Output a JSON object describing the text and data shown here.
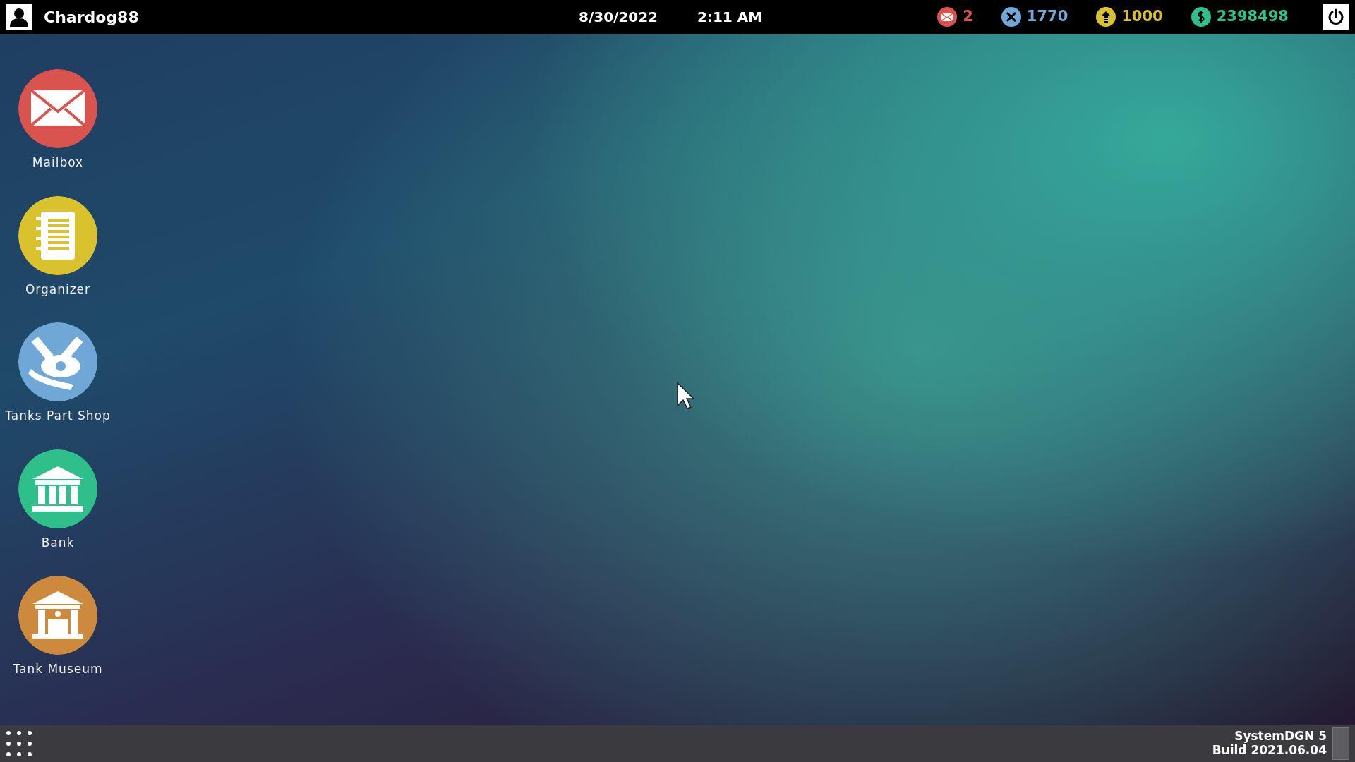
{
  "top_bar": {
    "username": "Chardog88",
    "date": "8/30/2022",
    "time": "2:11 AM",
    "counters": [
      {
        "kind": "mail",
        "value": "2",
        "color": "#d9534f"
      },
      {
        "kind": "parts",
        "value": "1770",
        "color": "#6fa8d6"
      },
      {
        "kind": "upgrade",
        "value": "1000",
        "color": "#d9c22e"
      },
      {
        "kind": "money",
        "value": "2398498",
        "color": "#2fbf8a"
      }
    ]
  },
  "desktop_icons": [
    {
      "kind": "mail",
      "label": "Mailbox",
      "color": "#d9534f"
    },
    {
      "kind": "organizer",
      "label": "Organizer",
      "color": "#d9c22e"
    },
    {
      "kind": "parts",
      "label": "Tanks Part Shop",
      "color": "#6fa8d6"
    },
    {
      "kind": "bank",
      "label": "Bank",
      "color": "#2fbf8a"
    },
    {
      "kind": "museum",
      "label": "Tank Museum",
      "color": "#cd8a3c"
    }
  ],
  "taskbar": {
    "system_name": "SystemDGN 5",
    "build": "Build 2021.06.04"
  }
}
